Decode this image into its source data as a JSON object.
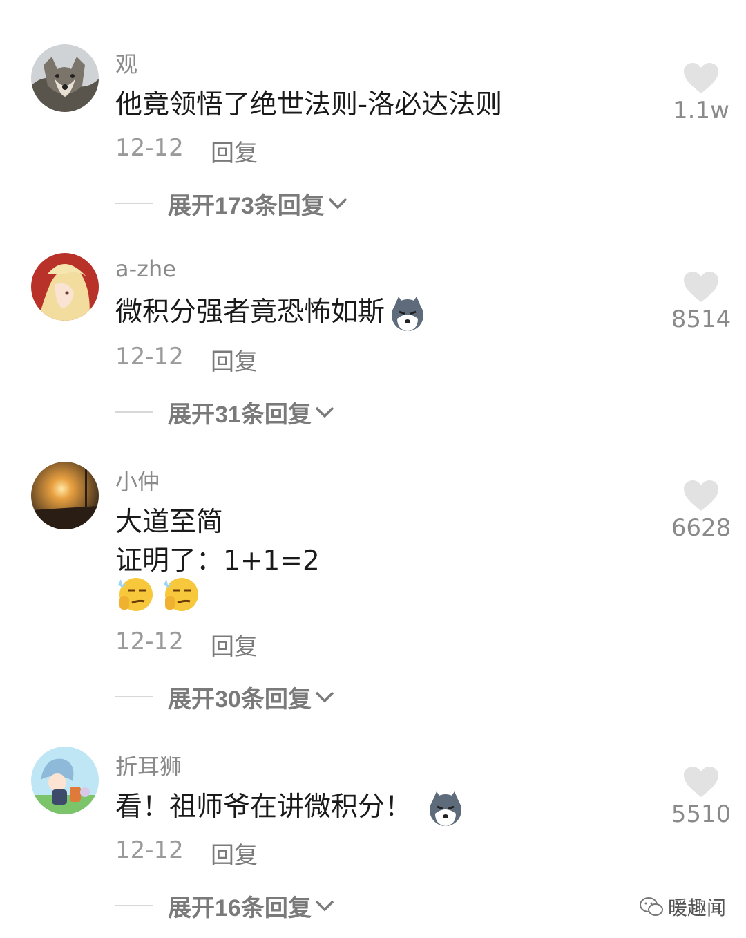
{
  "comments": [
    {
      "username": "观",
      "lines": [
        "他竟领悟了绝世法则-洛必达法则"
      ],
      "date": "12-12",
      "reply_label": "回复",
      "likes": "1.1w",
      "expand": {
        "prefix": "展开",
        "count": "173",
        "suffix": "条回复"
      }
    },
    {
      "username": "a-zhe",
      "lines": [
        "微积分强者竟恐怖如斯"
      ],
      "date": "12-12",
      "reply_label": "回复",
      "likes": "8514",
      "expand": {
        "prefix": "展开",
        "count": "31",
        "suffix": "条回复"
      }
    },
    {
      "username": "小仲",
      "lines": [
        "大道至简",
        "证明了：1+1=2"
      ],
      "date": "12-12",
      "reply_label": "回复",
      "likes": "6628",
      "expand": {
        "prefix": "展开",
        "count": "30",
        "suffix": "条回复"
      }
    },
    {
      "username": "折耳狮",
      "lines": [
        "看！祖师爷在讲微积分！"
      ],
      "date": "12-12",
      "reply_label": "回复",
      "likes": "5510",
      "expand": {
        "prefix": "展开",
        "count": "16",
        "suffix": "条回复"
      }
    }
  ],
  "watermark": "暖趣闻",
  "icons": {
    "like": "heart-icon",
    "expand": "chevron-down-icon",
    "emoji_dog": "husky-emoji-icon",
    "emoji_smirk": "smirk-emoji-icon",
    "watermark": "wechat-icon"
  },
  "colors": {
    "heart": "#e2e2e2",
    "secondary_text": "#8a8a8a",
    "primary_text": "#1a1a1a"
  }
}
